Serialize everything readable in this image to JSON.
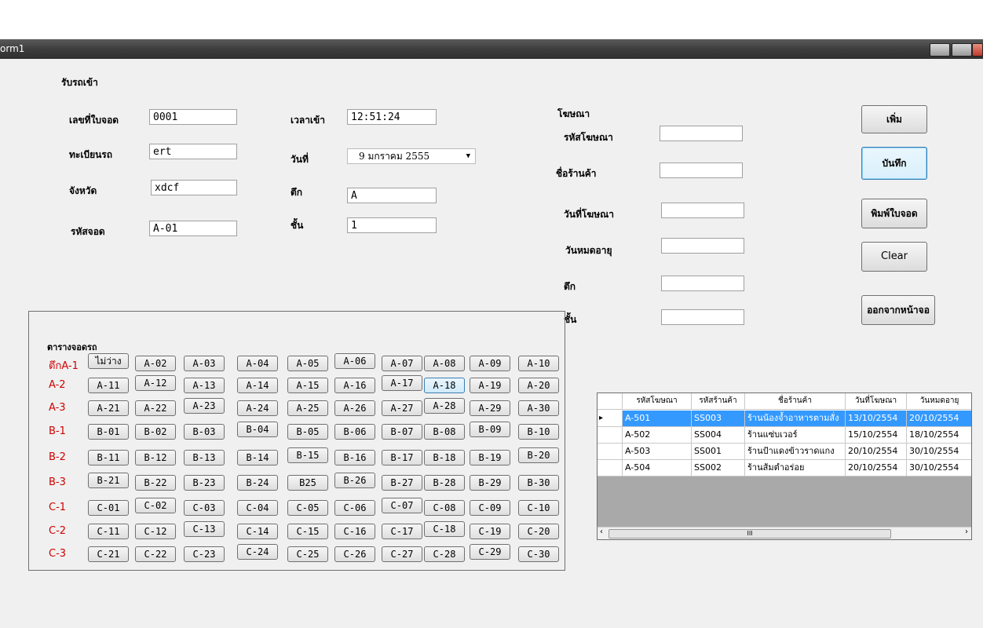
{
  "window": {
    "title": "orm1"
  },
  "entry": {
    "section_title": "รับรถเข้า",
    "parking_no_label": "เลขที่ใบจอด",
    "parking_no": "0001",
    "plate_label": "ทะเบียนรถ",
    "plate": "ert",
    "province_label": "จังหวัด",
    "province": "xdcf",
    "spot_code_label": "รหัสจอด",
    "spot_code": "A-01",
    "time_in_label": "เวลาเข้า",
    "time_in": "12:51:24",
    "date_label": "วันที่",
    "date_value": "9 มกราคม 2555",
    "building_label": "ตึก",
    "building": "A",
    "floor_label": "ชั้น",
    "floor": "1"
  },
  "ad": {
    "section_title": "โฆษณา",
    "ad_code_label": "รหัสโฆษณา",
    "shop_name_label": "ชื่อร้านค้า",
    "ad_date_label": "วันที่โฆษณา",
    "expire_label": "วันหมดอายุ",
    "building_label": "ตึก",
    "floor_label": "ชั้น"
  },
  "buttons": {
    "add": "เพิ่ม",
    "save": "บันทึก",
    "print": "พิมพ์ใบจอด",
    "clear": "Clear",
    "exit": "ออกจากหน้าจอ"
  },
  "parking": {
    "title": "ตารางจอดรถ",
    "rows": [
      {
        "label": "ตึกA-1",
        "spots": [
          "ไม่ว่าง",
          "A-02",
          "A-03",
          "A-04",
          "A-05",
          "A-06",
          "A-07",
          "A-08",
          "A-09",
          "A-10"
        ]
      },
      {
        "label": "A-2",
        "spots": [
          "A-11",
          "A-12",
          "A-13",
          "A-14",
          "A-15",
          "A-16",
          "A-17",
          "A-18",
          "A-19",
          "A-20"
        ]
      },
      {
        "label": "A-3",
        "spots": [
          "A-21",
          "A-22",
          "A-23",
          "A-24",
          "A-25",
          "A-26",
          "A-27",
          "A-28",
          "A-29",
          "A-30"
        ]
      },
      {
        "label": "B-1",
        "spots": [
          "B-01",
          "B-02",
          "B-03",
          "B-04",
          "B-05",
          "B-06",
          "B-07",
          "B-08",
          "B-09",
          "B-10"
        ]
      },
      {
        "label": "B-2",
        "spots": [
          "B-11",
          "B-12",
          "B-13",
          "B-14",
          "B-15",
          "B-16",
          "B-17",
          "B-18",
          "B-19",
          "B-20"
        ]
      },
      {
        "label": "B-3",
        "spots": [
          "B-21",
          "B-22",
          "B-23",
          "B-24",
          "B25",
          "B-26",
          "B-27",
          "B-28",
          "B-29",
          "B-30"
        ]
      },
      {
        "label": "C-1",
        "spots": [
          "C-01",
          "C-02",
          "C-03",
          "C-04",
          "C-05",
          "C-06",
          "C-07",
          "C-08",
          "C-09",
          "C-10"
        ]
      },
      {
        "label": "C-2",
        "spots": [
          "C-11",
          "C-12",
          "C-13",
          "C-14",
          "C-15",
          "C-16",
          "C-17",
          "C-18",
          "C-19",
          "C-20"
        ]
      },
      {
        "label": "C-3",
        "spots": [
          "C-21",
          "C-22",
          "C-23",
          "C-24",
          "C-25",
          "C-26",
          "C-27",
          "C-28",
          "C-29",
          "C-30"
        ]
      }
    ]
  },
  "ad_grid": {
    "columns": [
      "รหัสโฆษณา",
      "รหัสร้านค้า",
      "ชื่อร้านค้า",
      "วันที่โฆษณา",
      "วันหมดอายุ"
    ],
    "rows": [
      [
        "A-501",
        "SS003",
        "ร้านน้องจ้ำอาหารตามสั่ง",
        "13/10/2554",
        "20/10/2554"
      ],
      [
        "A-502",
        "SS004",
        "ร้านแซ่บเวอร์",
        "15/10/2554",
        "18/10/2554"
      ],
      [
        "A-503",
        "SS001",
        "ร้านป้าแดงข้าวราดแกง",
        "20/10/2554",
        "30/10/2554"
      ],
      [
        "A-504",
        "SS002",
        "ร้านส้มตำอร่อย",
        "20/10/2554",
        "30/10/2554"
      ]
    ],
    "row_indicator": "▸",
    "scroll_left": "‹",
    "scroll_right": "›",
    "scroll_grip": "III"
  },
  "colors": {
    "row_label": "#d00000",
    "selection": "#3399ff"
  }
}
